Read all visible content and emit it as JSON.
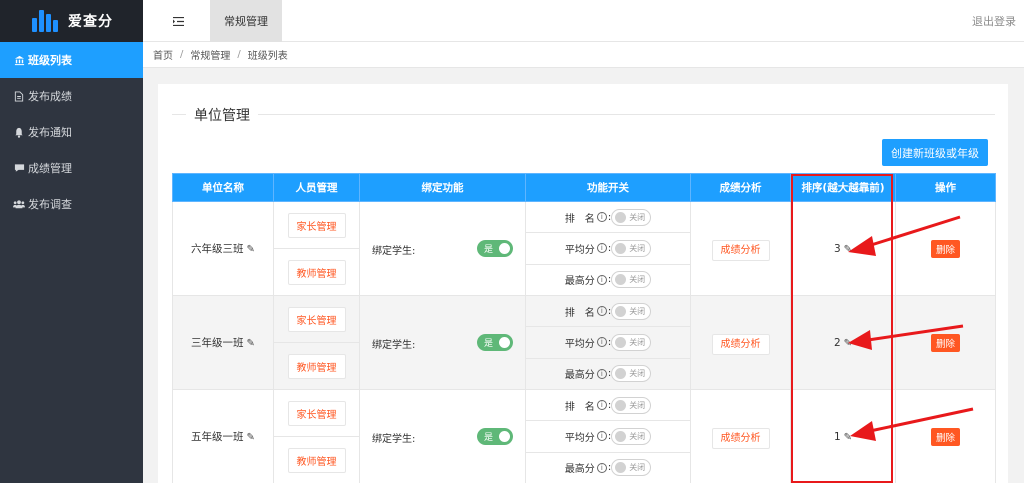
{
  "app": {
    "title": "爱查分"
  },
  "sidebar": {
    "items": [
      {
        "label": "班级列表",
        "icon": "bank-icon",
        "active": true
      },
      {
        "label": "发布成绩",
        "icon": "document-icon",
        "active": false
      },
      {
        "label": "发布通知",
        "icon": "bell-icon",
        "active": false
      },
      {
        "label": "成绩管理",
        "icon": "chat-icon",
        "active": false
      },
      {
        "label": "发布调查",
        "icon": "users-icon",
        "active": false
      }
    ]
  },
  "topbar": {
    "tab": "常规管理",
    "logout": "退出登录"
  },
  "breadcrumb": [
    "首页",
    "常规管理",
    "班级列表"
  ],
  "panel": {
    "title": "单位管理",
    "create_button": "创建新班级或年级"
  },
  "table": {
    "headers": [
      "单位名称",
      "人员管理",
      "绑定功能",
      "功能开关",
      "成绩分析",
      "排序(越大越靠前)",
      "操作"
    ],
    "rows": [
      {
        "name": "六年级三班",
        "parent_btn": "家长管理",
        "teacher_btn": "教师管理",
        "bind_label": "绑定学生:",
        "bind_switch": "是",
        "features": [
          {
            "label": "排　名",
            "state": "关闭"
          },
          {
            "label": "平均分",
            "state": "关闭"
          },
          {
            "label": "最高分",
            "state": "关闭"
          }
        ],
        "analysis_btn": "成绩分析",
        "rank": "3",
        "delete_btn": "删除"
      },
      {
        "name": "三年级一班",
        "parent_btn": "家长管理",
        "teacher_btn": "教师管理",
        "bind_label": "绑定学生:",
        "bind_switch": "是",
        "features": [
          {
            "label": "排　名",
            "state": "关闭"
          },
          {
            "label": "平均分",
            "state": "关闭"
          },
          {
            "label": "最高分",
            "state": "关闭"
          }
        ],
        "analysis_btn": "成绩分析",
        "rank": "2",
        "delete_btn": "删除"
      },
      {
        "name": "五年级一班",
        "parent_btn": "家长管理",
        "teacher_btn": "教师管理",
        "bind_label": "绑定学生:",
        "bind_switch": "是",
        "features": [
          {
            "label": "排　名",
            "state": "关闭"
          },
          {
            "label": "平均分",
            "state": "关闭"
          },
          {
            "label": "最高分",
            "state": "关闭"
          }
        ],
        "analysis_btn": "成绩分析",
        "rank": "1",
        "delete_btn": "删除"
      }
    ]
  },
  "colors": {
    "primary": "#1e9fff",
    "sidebar": "#2f3540",
    "danger": "#ff5722",
    "switch_on": "#5fb878",
    "annotation": "#e8191b"
  }
}
